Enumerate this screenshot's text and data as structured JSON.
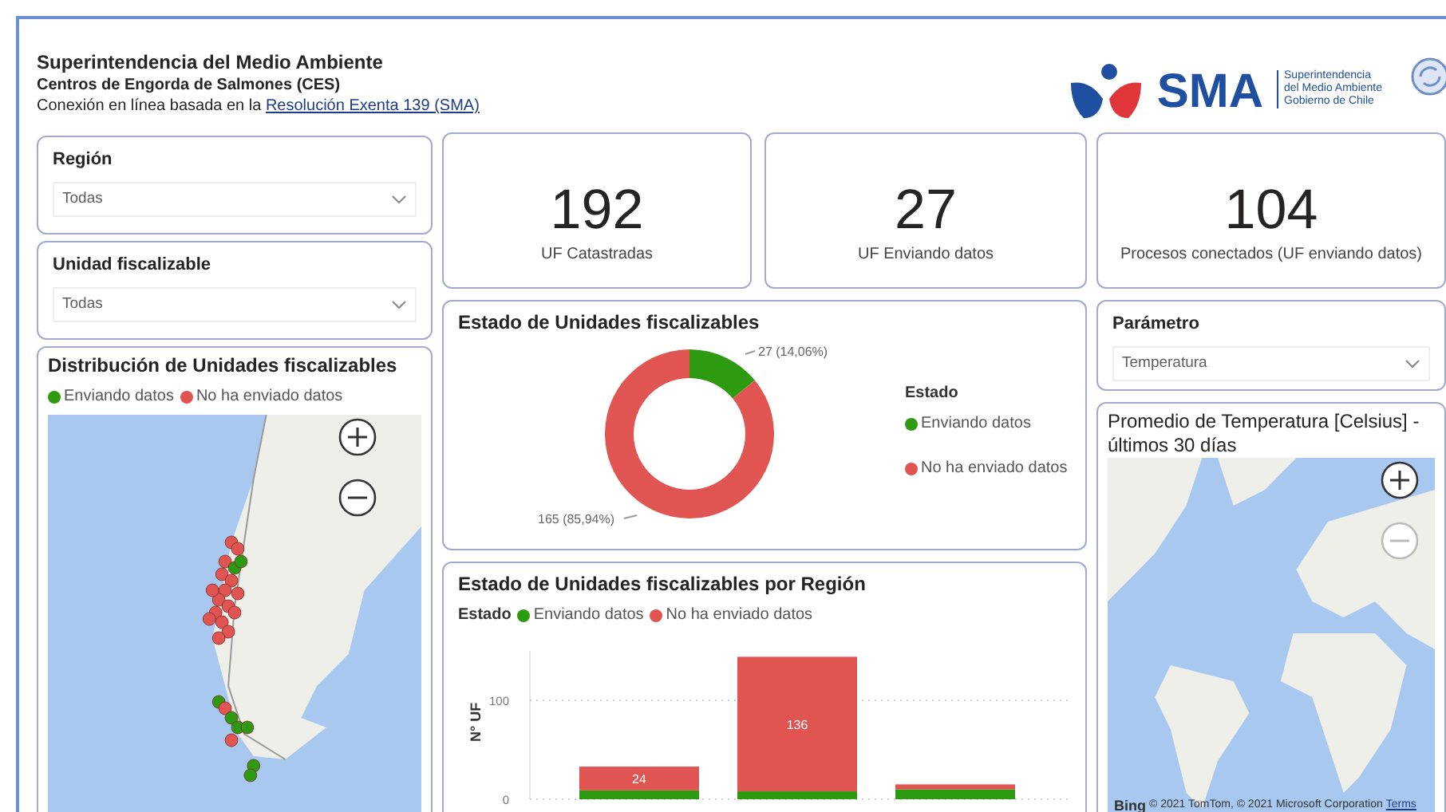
{
  "header": {
    "title": "Superintendencia del Medio Ambiente",
    "subtitle": "Centros de Engorda de Salmones (CES)",
    "connection_text": "Conexión en línea basada en la",
    "connection_link": "Resolución Exenta 139 (SMA)"
  },
  "logo": {
    "acronym": "SMA",
    "lines": [
      "Superintendencia",
      "del Medio Ambiente",
      "Gobierno de Chile"
    ]
  },
  "filters": [
    {
      "label": "Región",
      "value": "Todas"
    },
    {
      "label": "Unidad fiscalizable",
      "value": "Todas"
    }
  ],
  "distribution_map": {
    "title": "Distribución de Unidades fiscalizables",
    "legend": [
      {
        "label": "Enviando datos",
        "color": "#2e9a12"
      },
      {
        "label": "No ha enviado datos",
        "color": "#e05552"
      }
    ]
  },
  "kpis": [
    {
      "value": "192",
      "label": "UF Catastradas"
    },
    {
      "value": "27",
      "label": "UF Enviando datos"
    },
    {
      "value": "104",
      "label": "Procesos conectados (UF enviando datos)"
    }
  ],
  "donut_card": {
    "title": "Estado de Unidades fiscalizables",
    "chart_data": {
      "type": "donut",
      "legend": {
        "title": "Estado"
      },
      "categories": [
        "Enviando datos",
        "No ha enviado datos"
      ],
      "colors": [
        "#2e9a12",
        "#e05552"
      ],
      "values": [
        27,
        165
      ],
      "value_labels": [
        "27 (14,06%)",
        "165 (85,94%)"
      ]
    }
  },
  "bar_card": {
    "title": "Estado de Unidades fiscalizables por Región",
    "chart_data": {
      "type": "bar",
      "legend": {
        "title": "Estado"
      },
      "stacked": true,
      "ylabel": "N° UF",
      "ylim": [
        0,
        150
      ],
      "yticks": [
        0,
        100
      ],
      "series": [
        {
          "name": "Enviando datos",
          "color": "#2e9a12",
          "values": [
            9,
            8,
            10
          ]
        },
        {
          "name": "No ha enviado datos",
          "color": "#e05552",
          "values": [
            24,
            136,
            5
          ],
          "value_labels": [
            "24",
            "136",
            null
          ]
        }
      ]
    }
  },
  "parameter_filter": {
    "label": "Parámetro",
    "value": "Temperatura"
  },
  "temperature_map": {
    "title": "Promedio de Temperatura [Celsius] - últimos 30 días",
    "provider": "Bing",
    "attribution": "© 2021 TomTom, © 2021 Microsoft Corporation",
    "terms_link": "Terms"
  }
}
